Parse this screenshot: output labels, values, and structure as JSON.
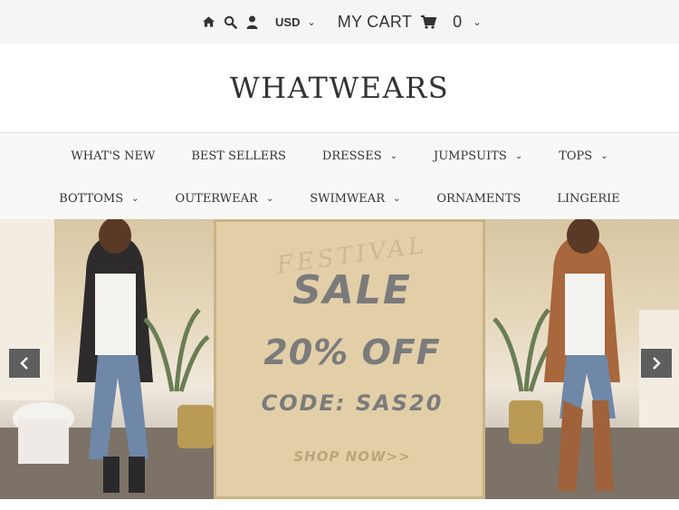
{
  "topbar": {
    "icons": [
      "home-icon",
      "search-icon",
      "user-icon"
    ],
    "currency": "USD",
    "cart_label": "MY CART",
    "cart_count": "0"
  },
  "logo": "WHATWEARS",
  "nav": {
    "row1": [
      {
        "label": "WHAT'S NEW",
        "dropdown": false
      },
      {
        "label": "BEST SELLERS",
        "dropdown": false
      },
      {
        "label": "DRESSES",
        "dropdown": true
      },
      {
        "label": "JUMPSUITS",
        "dropdown": true
      },
      {
        "label": "TOPS",
        "dropdown": true
      }
    ],
    "row2": [
      {
        "label": "BOTTOMS",
        "dropdown": true
      },
      {
        "label": "OUTERWEAR",
        "dropdown": true
      },
      {
        "label": "SWIMWEAR",
        "dropdown": true
      },
      {
        "label": "ORNAMENTS",
        "dropdown": false
      },
      {
        "label": "LINGERIE",
        "dropdown": false
      }
    ]
  },
  "hero": {
    "festival": "FESTIVAL",
    "sale": "SALE",
    "off": "20% OFF",
    "code": "CODE:  SAS20",
    "shop": "SHOP NOW>>"
  },
  "colors": {
    "topbar_bg": "#f5f5f5",
    "nav_bg": "#f8f8f8",
    "promo_bg": "#e2cfa8",
    "promo_text": "#7b7b7b",
    "arrow_bg": "#5e5e5e"
  }
}
